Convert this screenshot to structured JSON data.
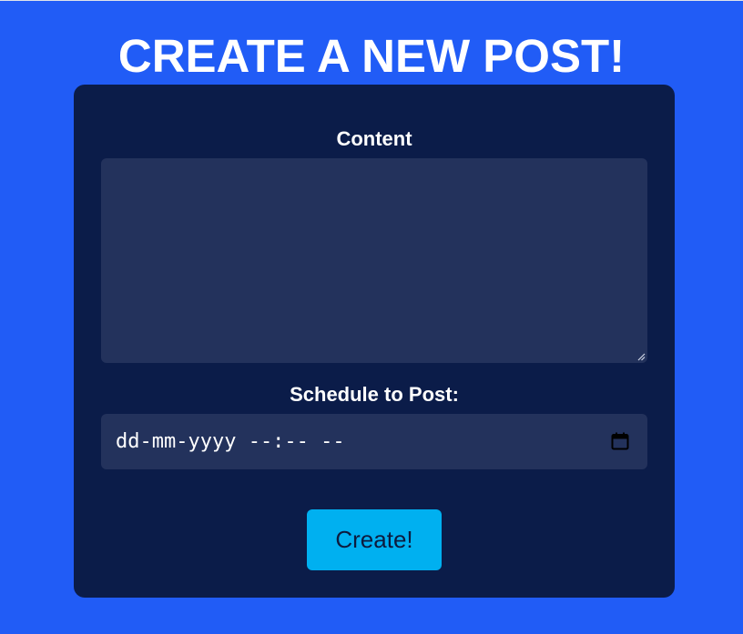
{
  "page": {
    "title": "CREATE A NEW POST!"
  },
  "form": {
    "content_label": "Content",
    "content_value": "",
    "schedule_label": "Schedule to Post:",
    "schedule_value": "dd-mm-yyyy --:-- --",
    "submit_label": "Create!"
  },
  "icons": {
    "datetime_picker": "calendar-icon",
    "textarea_resize": "resize-handle-icon"
  },
  "colors": {
    "background": "#215cf6",
    "card": "#0b1c49",
    "input_background": "#23325c",
    "button": "#00b0f0",
    "text": "#ffffff"
  }
}
